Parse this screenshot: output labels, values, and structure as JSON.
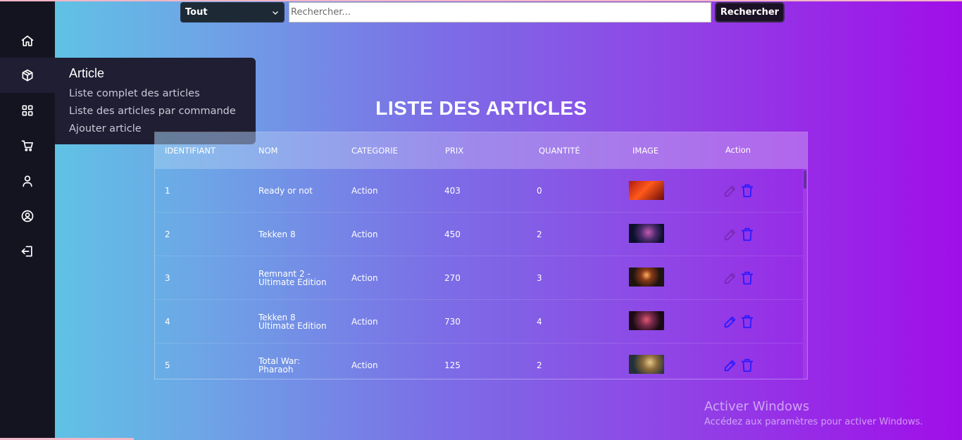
{
  "search": {
    "category_selected": "Tout",
    "placeholder": "Rechercher...",
    "button_label": "Rechercher"
  },
  "sidebar": {
    "items": [
      {
        "icon": "home-icon"
      },
      {
        "icon": "box-icon"
      },
      {
        "icon": "grid-icon"
      },
      {
        "icon": "cart-icon"
      },
      {
        "icon": "user-icon"
      },
      {
        "icon": "user-circle-icon"
      },
      {
        "icon": "logout-icon"
      }
    ]
  },
  "flyout": {
    "title": "Article",
    "links": [
      "Liste complet des articles",
      "Liste des articles par commande",
      "Ajouter article"
    ]
  },
  "page": {
    "title": "LISTE DES ARTICLES"
  },
  "table": {
    "headers": {
      "id": "IDENTIFIANT",
      "name": "NOM",
      "category": "CATEGORIE",
      "price": "PRIX",
      "quantity": "QUANTITÉ",
      "image": "IMAGE",
      "action": "Action"
    },
    "rows": [
      {
        "id": "1",
        "name_line1": "Ready or not",
        "name_line2": "",
        "category": "Action",
        "price": "403",
        "quantity": "0"
      },
      {
        "id": "2",
        "name_line1": "Tekken 8",
        "name_line2": "",
        "category": "Action",
        "price": "450",
        "quantity": "2"
      },
      {
        "id": "3",
        "name_line1": "Remnant 2 -",
        "name_line2": "Ultimate Edition",
        "category": "Action",
        "price": "270",
        "quantity": "3"
      },
      {
        "id": "4",
        "name_line1": "Tekken 8",
        "name_line2": "Ultimate Edition",
        "category": "Action",
        "price": "730",
        "quantity": "4"
      },
      {
        "id": "5",
        "name_line1": "Total War:",
        "name_line2": "Pharaoh",
        "category": "Action",
        "price": "125",
        "quantity": "2"
      }
    ]
  },
  "watermark": {
    "title": "Activer Windows",
    "subtitle": "Accédez aux paramètres pour activer Windows."
  },
  "colors": {
    "sidebar_bg": "#141421",
    "flyout_bg": "#1f1e33",
    "edit_icon_faded": "#7a2bb8",
    "edit_icon_bright": "#2a1bff",
    "delete_icon": "#2a1bff"
  }
}
